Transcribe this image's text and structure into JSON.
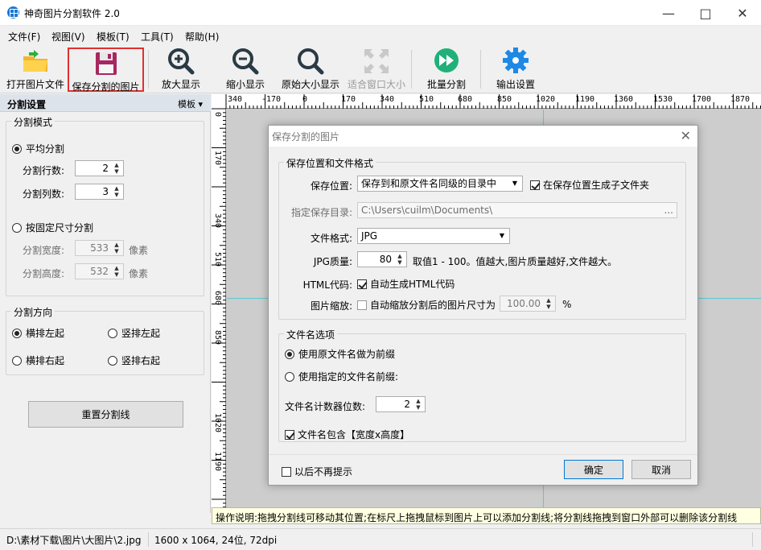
{
  "app": {
    "title": "神奇图片分割软件 2.0"
  },
  "menu": [
    "文件(F)",
    "视图(V)",
    "模板(T)",
    "工具(T)",
    "帮助(H)"
  ],
  "toolbar": {
    "open": "打开图片文件",
    "save": "保存分割的图片",
    "zoom_in": "放大显示",
    "zoom_out": "缩小显示",
    "original": "原始大小显示",
    "fit": "适合窗口大小",
    "batch": "批量分割",
    "output": "输出设置"
  },
  "left": {
    "header": "分割设置",
    "template": "模板",
    "mode_group": "分割模式",
    "avg": "平均分割",
    "rows_label": "分割行数:",
    "rows": "2",
    "cols_label": "分割列数:",
    "cols": "3",
    "fixed": "按固定尺寸分割",
    "w_label": "分割宽度:",
    "w": "533",
    "h_label": "分割高度:",
    "h": "532",
    "unit": "像素",
    "dir_group": "分割方向",
    "dir1": "横排左起",
    "dir2": "竖排左起",
    "dir3": "横排右起",
    "dir4": "竖排右起",
    "reset": "重置分割线"
  },
  "ruler": {
    "top": [
      "340",
      "-170",
      "0",
      "170",
      "340",
      "510",
      "680",
      "850",
      "1020",
      "1190",
      "1360",
      "1530",
      "1700",
      "1870"
    ],
    "left": [
      "0",
      "170",
      "340",
      "510",
      "680",
      "850",
      "1020",
      "1190"
    ]
  },
  "dialog": {
    "title": "保存分割的图片",
    "section1": "保存位置和文件格式",
    "loc_label": "保存位置:",
    "loc_value": "保存到和原文件名同级的目录中",
    "subfolder": "在保存位置生成子文件夹",
    "dir_label": "指定保存目录:",
    "dir_value": "C:\\Users\\cuilm\\Documents\\",
    "dir_btn": "...",
    "fmt_label": "文件格式:",
    "fmt_value": "JPG",
    "q_label": "JPG质量:",
    "q_value": "80",
    "q_hint": "取值1 - 100。值越大,图片质量越好,文件越大。",
    "html_label": "HTML代码:",
    "html_chk": "自动生成HTML代码",
    "scale_label": "图片缩放:",
    "scale_chk": "自动缩放分割后的图片尺寸为",
    "scale_value": "100.00",
    "pct": "%",
    "section2": "文件名选项",
    "opt1": "使用原文件名做为前缀",
    "opt2": "使用指定的文件名前缀:",
    "counter_label": "文件名计数器位数:",
    "counter": "2",
    "include_size": "文件名包含【宽度x高度】",
    "noshow": "以后不再提示",
    "ok": "确定",
    "cancel": "取消"
  },
  "hint": "操作说明:拖拽分割线可移动其位置;在标尺上拖拽鼠标到图片上可以添加分割线;将分割线拖拽到窗口外部可以删除该分割线",
  "status": {
    "path": "D:\\素材下载\\图片\\大图片\\2.jpg",
    "info": "1600 x 1064, 24位, 72dpi"
  }
}
